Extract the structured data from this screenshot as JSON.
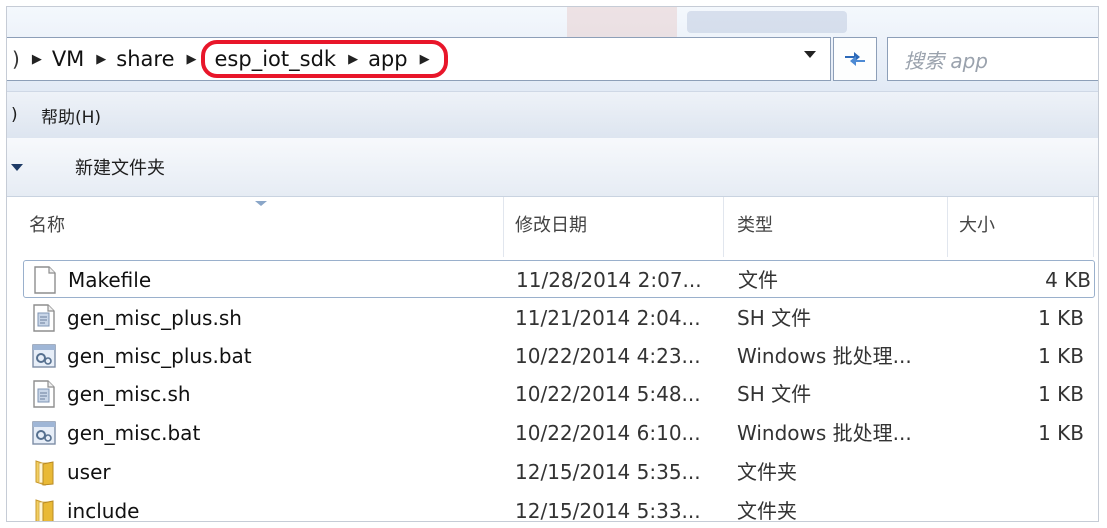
{
  "address_bar": {
    "leading": ")",
    "crumbs": [
      "VM",
      "share",
      "esp_iot_sdk",
      "app"
    ]
  },
  "search": {
    "placeholder": "搜索 app"
  },
  "menu": {
    "leading": ")",
    "help": "帮助(H)"
  },
  "toolbar": {
    "new_folder": "新建文件夹"
  },
  "columns": {
    "name": "名称",
    "date": "修改日期",
    "type": "类型",
    "size": "大小"
  },
  "files": [
    {
      "name": "Makefile",
      "date": "11/28/2014 2:07...",
      "type": "文件",
      "size": "4 KB",
      "icon": "blank-file-icon"
    },
    {
      "name": "gen_misc_plus.sh",
      "date": "11/21/2014 2:04...",
      "type": "SH 文件",
      "size": "1 KB",
      "icon": "text-file-icon"
    },
    {
      "name": "gen_misc_plus.bat",
      "date": "10/22/2014 4:23...",
      "type": "Windows 批处理...",
      "size": "1 KB",
      "icon": "batch-file-icon"
    },
    {
      "name": "gen_misc.sh",
      "date": "10/22/2014 5:48...",
      "type": "SH 文件",
      "size": "1 KB",
      "icon": "text-file-icon"
    },
    {
      "name": "gen_misc.bat",
      "date": "10/22/2014 6:10...",
      "type": "Windows 批处理...",
      "size": "1 KB",
      "icon": "batch-file-icon"
    },
    {
      "name": "user",
      "date": "12/15/2014 5:35...",
      "type": "文件夹",
      "size": "",
      "icon": "folder-icon"
    },
    {
      "name": "include",
      "date": "12/15/2014 5:33...",
      "type": "文件夹",
      "size": "",
      "icon": "folder-icon"
    }
  ],
  "colors": {
    "highlight": "#e8162a",
    "folder": "#e9b936"
  }
}
